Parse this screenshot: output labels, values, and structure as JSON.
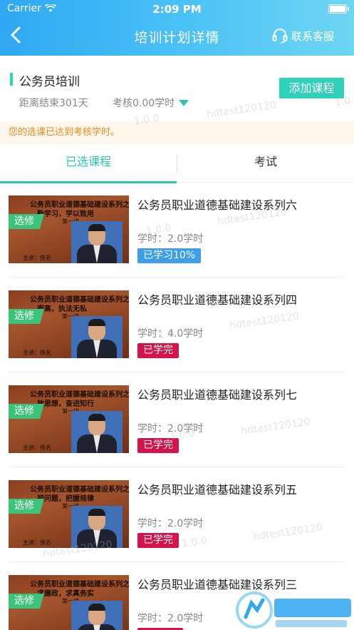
{
  "status_bar": {
    "carrier": "Carrier",
    "time": "2:09 PM"
  },
  "nav": {
    "title": "培训计划详情",
    "service_label": "联系客服"
  },
  "plan": {
    "name": "公务员培训",
    "remaining": "距离结束301天",
    "assessment": "考核0.00学时",
    "add_button": "添加课程"
  },
  "notice": "您的选课已达到考核学时。",
  "tabs": [
    {
      "label": "已选课程",
      "active": true
    },
    {
      "label": "考试",
      "active": false
    }
  ],
  "courses": [
    {
      "title": "公务员职业道德基础建设系列六",
      "hours": "学时：2.0学时",
      "status": "已学习10%",
      "status_type": "progress",
      "tag": "选修",
      "thumb_line1": "公务员职业道德基础建设系列之",
      "thumb_line2": "勤学习，学以致用",
      "thumb_line3": "第一讲",
      "thumb_line4": "主讲：佚名"
    },
    {
      "title": "公务员职业道德基础建设系列四",
      "hours": "学时：4.0学时",
      "status": "已学完",
      "status_type": "done",
      "tag": "选修",
      "thumb_line1": "公务员职业道德基础建设系列之",
      "thumb_line2": "崇高，执法无私",
      "thumb_line3": "第一讲",
      "thumb_line4": "主讲：佚名"
    },
    {
      "title": "公务员职业道德基础建设系列七",
      "hours": "学时：2.0学时",
      "status": "已学完",
      "status_type": "done",
      "tag": "选修",
      "thumb_line1": "公务员职业道德基础建设系列之",
      "thumb_line2": "放思想，奋进知行",
      "thumb_line3": "第一讲",
      "thumb_line4": "主讲：佚名"
    },
    {
      "title": "公务员职业道德基础建设系列五",
      "hours": "学时：2.0学时",
      "status": "已学完",
      "status_type": "done",
      "tag": "选修",
      "thumb_line1": "公务员职业道德基础建设系列之",
      "thumb_line2": "视问题，把握规律",
      "thumb_line3": "第一讲",
      "thumb_line4": "主讲：佚名"
    },
    {
      "title": "公务员职业道德基础建设系列三",
      "hours": "学时：2.0学时",
      "status": "",
      "status_type": "done",
      "tag": "选修",
      "thumb_line1": "公务员职业道德基础建设系列之",
      "thumb_line2": "求廉政，求真务实",
      "thumb_line3": "第一讲",
      "thumb_line4": "主讲：佚名"
    }
  ],
  "watermark": {
    "text": "hdtest120120",
    "version": "1.0.0"
  },
  "colors": {
    "header_start": "#2ea8f3",
    "accent": "#2cc5b0",
    "progress": "#3d9fe9",
    "done": "#d6134a",
    "elective": "#3cc37a",
    "notice_text": "#ef8a1c"
  },
  "icons": {
    "back": "chevron-left-icon",
    "service": "headset-icon",
    "dropdown": "triangle-down-icon",
    "wifi": "wifi-icon",
    "battery": "battery-icon"
  }
}
